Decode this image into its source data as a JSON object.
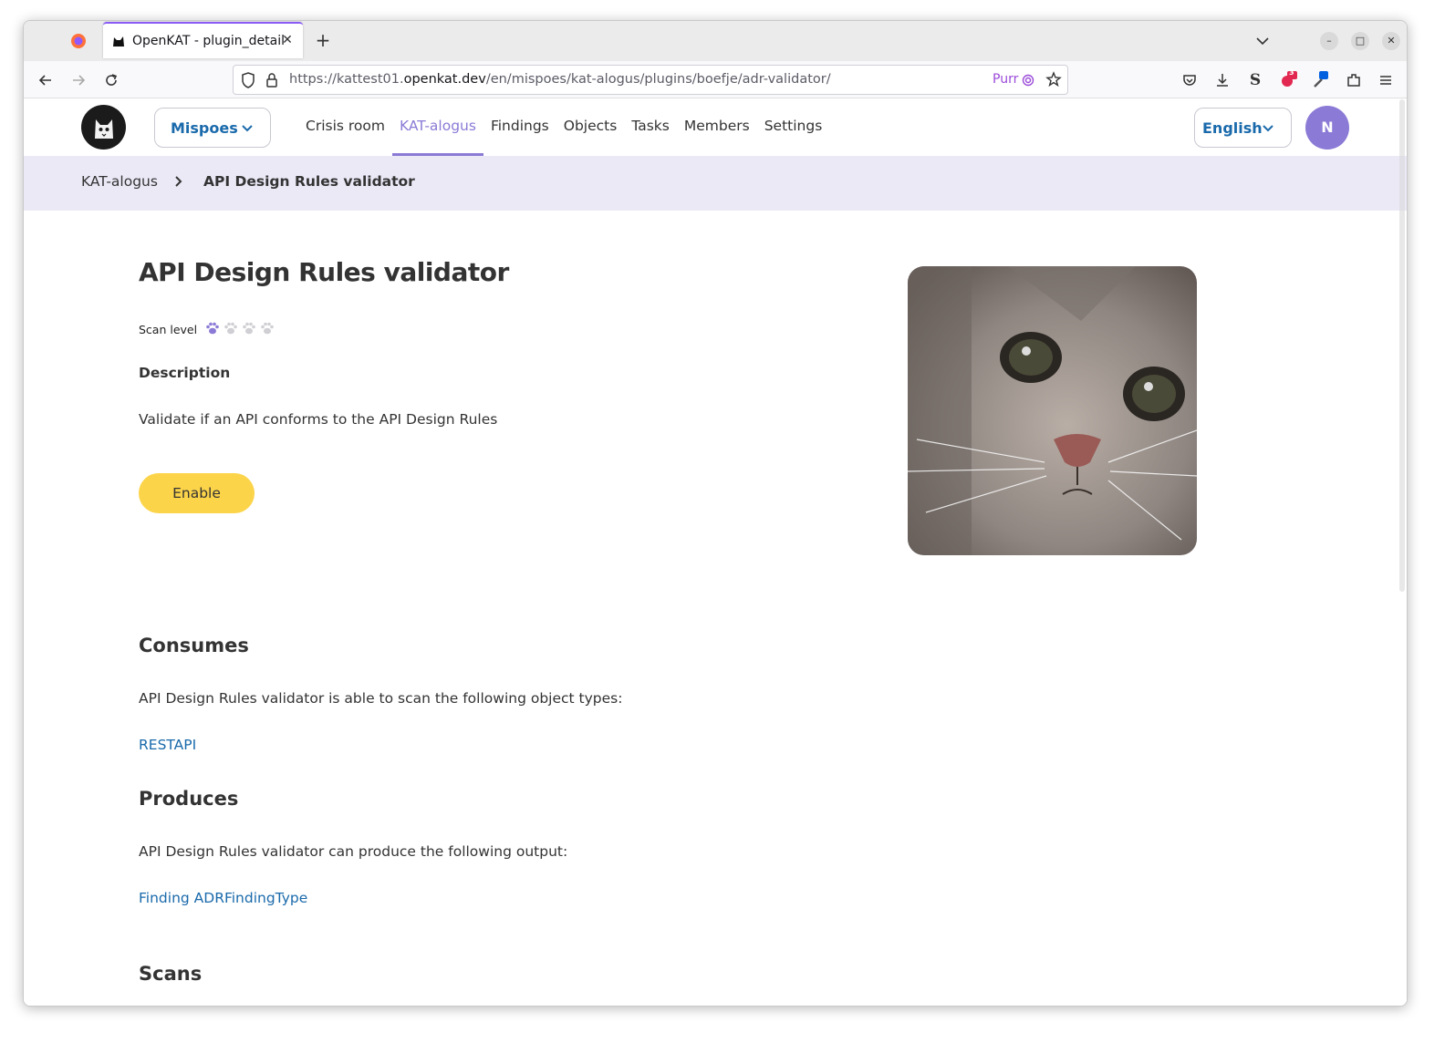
{
  "browser": {
    "tab_title": "OpenKAT - plugin_detail",
    "url_prefix": "https://kattest01.",
    "url_host": "openkat.dev",
    "url_path": "/en/mispoes/kat-alogus/plugins/boefje/adr-validator/",
    "purr_label": "Purr",
    "badge_count": "3",
    "icons": [
      "firefox-icon",
      "back-icon",
      "forward-icon",
      "reload-icon",
      "shield-icon",
      "lock-icon",
      "star-icon",
      "pocket-icon",
      "download-icon",
      "extension-icon",
      "menu-icon"
    ]
  },
  "header": {
    "org_name": "Mispoes",
    "nav": [
      "Crisis room",
      "KAT-alogus",
      "Findings",
      "Objects",
      "Tasks",
      "Members",
      "Settings"
    ],
    "active_nav": "KAT-alogus",
    "language": "English",
    "avatar_initial": "N"
  },
  "breadcrumb": {
    "parent": "KAT-alogus",
    "current": "API Design Rules validator"
  },
  "plugin": {
    "title": "API Design Rules validator",
    "scan_level_label": "Scan level",
    "scan_level": 1,
    "scan_level_max": 4,
    "description_heading": "Description",
    "description": "Validate if an API conforms to the API Design Rules",
    "enable_label": "Enable"
  },
  "consumes": {
    "heading": "Consumes",
    "text": "API Design Rules validator is able to scan the following object types:",
    "items": [
      "RESTAPI"
    ]
  },
  "produces": {
    "heading": "Produces",
    "text": "API Design Rules validator can produce the following output:",
    "items": [
      "Finding ADRFindingType"
    ]
  },
  "scans": {
    "heading": "Scans"
  },
  "colors": {
    "accent": "#8b7ad6",
    "link": "#1a6aab",
    "button": "#fcd44a",
    "breadcrumb_bg": "#ece9f7"
  }
}
